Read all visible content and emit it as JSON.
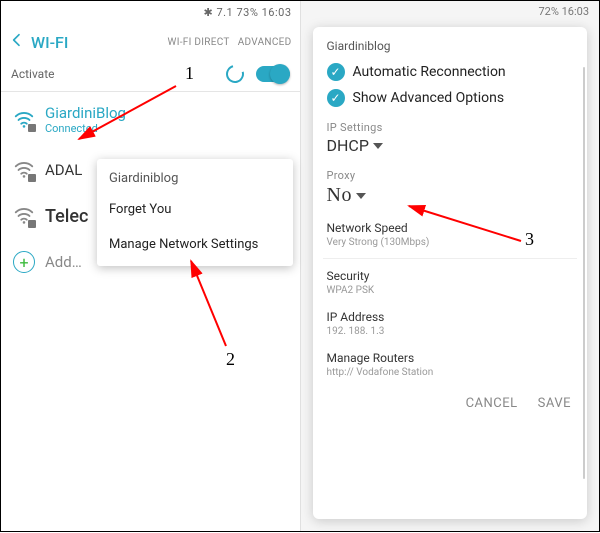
{
  "left": {
    "statusbar": "✱ 7.1 73% 16:03",
    "title": "WI-FI",
    "header_links": {
      "direct": "WI-FI DIRECT",
      "advanced": "ADVANCED"
    },
    "activate": "Activate",
    "networks": {
      "connected": {
        "name": "GiardiniBlog",
        "status": "Connected"
      },
      "adal": {
        "name": "ADAL"
      },
      "telecom": {
        "name": "Telec"
      },
      "add": {
        "label": "Add…"
      }
    },
    "context_menu": {
      "title": "Giardiniblog",
      "forget": "Forget You",
      "manage": "Manage Network Settings"
    }
  },
  "right": {
    "statusbar": "72% 16:03",
    "title": "Giardiniblog",
    "auto_reconnect": "Automatic Reconnection",
    "show_advanced": "Show Advanced Options",
    "ip_settings_label": "IP Settings",
    "ip_settings_value": "DHCP",
    "proxy_label": "Proxy",
    "proxy_value": "No",
    "speed_label": "Network Speed",
    "speed_value": "Very Strong (130Mbps)",
    "security_label": "Security",
    "security_value": "WPA2 PSK",
    "ip_addr_label": "IP Address",
    "ip_addr_value": "192. 188. 1.3",
    "routers_label": "Manage Routers",
    "routers_value": "http:// Vodafone Station",
    "cancel": "CANCEL",
    "save": "SAVE"
  },
  "annotations": {
    "n1": "1",
    "n2": "2",
    "n3": "3"
  }
}
